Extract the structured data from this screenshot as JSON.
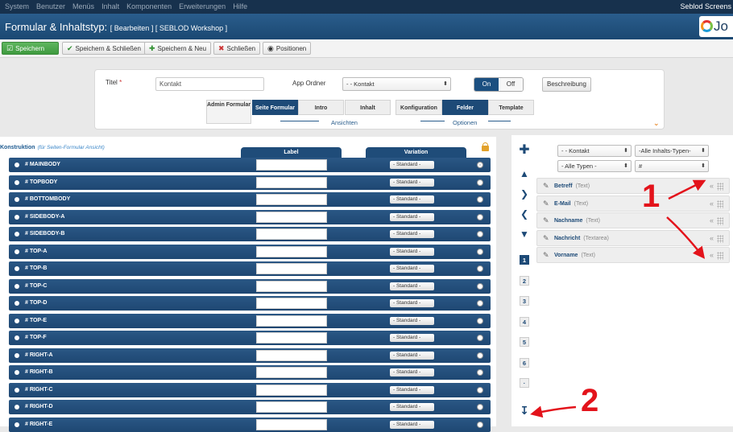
{
  "topmenu": {
    "items": [
      "System",
      "Benutzer",
      "Menüs",
      "Inhalt",
      "Komponenten",
      "Erweiterungen",
      "Hilfe"
    ],
    "site_name": "Seblod Screens"
  },
  "header": {
    "title": "Formular & Inhaltstyp:",
    "subtitle": "[ Bearbeiten ] [ SEBLOD Workshop ]",
    "logo_text": "Jo"
  },
  "toolbar": {
    "save": "Speichern",
    "save_close": "Speichern & Schließen",
    "save_new": "Speichern & Neu",
    "close": "Schließen",
    "positions": "Positionen"
  },
  "form": {
    "title_label": "Titel",
    "title_required": "*",
    "title_value": "Kontakt",
    "app_folder_label": "App Ordner",
    "app_folder_value": "- - Kontakt",
    "toggle_on": "On",
    "toggle_off": "Off",
    "description_button": "Beschreibung",
    "tabs_views": [
      "Admin Formular",
      "Seite Formular",
      "Intro",
      "Inhalt"
    ],
    "tabs_views_group": "Ansichten",
    "tabs_options": [
      "Konfiguration",
      "Felder",
      "Template"
    ],
    "tabs_options_group": "Optionen",
    "collapse_icon": "chevron-down-icon"
  },
  "construction": {
    "title": "Konstruktion",
    "subtitle": "(für Seiten-Formular Ansicht)",
    "col_label": "Label",
    "col_variation": "Variation",
    "variation_default": "- Standard -",
    "rows": [
      "# MAINBODY",
      "# TOPBODY",
      "# BOTTOMBODY",
      "# SIDEBODY-A",
      "# SIDEBODY-B",
      "# TOP-A",
      "# TOP-B",
      "# TOP-C",
      "# TOP-D",
      "# TOP-E",
      "# TOP-F",
      "# RIGHT-A",
      "# RIGHT-B",
      "# RIGHT-C",
      "# RIGHT-D",
      "# RIGHT-E"
    ]
  },
  "fields": {
    "filter_app": "- - Kontakt",
    "filter_content_types": "-Alle Inhalts-Typen-",
    "filter_types": "- Alle Typen -",
    "filter_search": "#",
    "pages": [
      "1",
      "2",
      "3",
      "4",
      "5",
      "6",
      "·"
    ],
    "items": [
      {
        "name": "Betreff",
        "type": "(Text)"
      },
      {
        "name": "E-Mail",
        "type": "(Text)"
      },
      {
        "name": "Nachname",
        "type": "(Text)"
      },
      {
        "name": "Nachricht",
        "type": "(Textarea)"
      },
      {
        "name": "Vorname",
        "type": "(Text)"
      }
    ]
  },
  "annotations": {
    "one": "1",
    "two": "2"
  },
  "colors": {
    "accent": "#1d4a77",
    "annotation": "#e3131b",
    "save_green": "#4aa84a"
  }
}
